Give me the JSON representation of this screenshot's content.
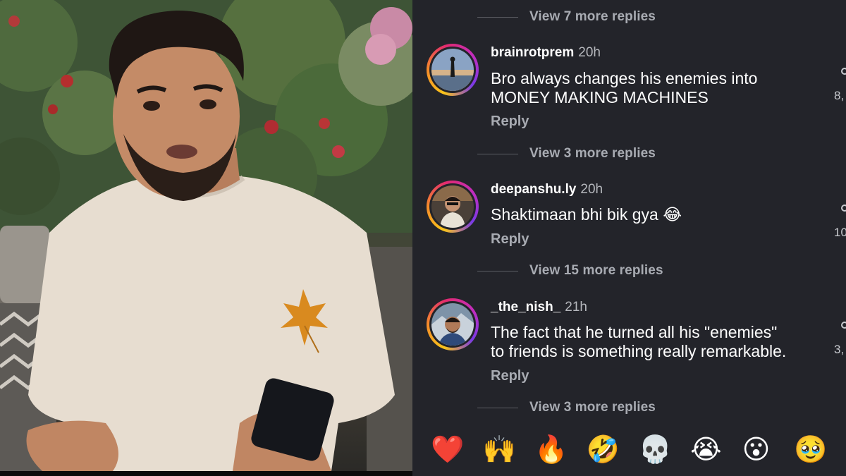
{
  "comments_panel": {
    "top_more_replies": "View 7 more replies",
    "comments": [
      {
        "username": "brainrotprem",
        "time": "20h",
        "text_lines": [
          "Bro always changes his enemies into",
          "MONEY MAKING MACHINES"
        ],
        "reply_label": "Reply",
        "like_count": "8,",
        "more_replies": "View 3 more replies"
      },
      {
        "username": "deepanshu.ly",
        "time": "20h",
        "text_lines": [
          "Shaktimaan bhi bik gya 😂"
        ],
        "reply_label": "Reply",
        "like_count": "10",
        "more_replies": "View 15 more replies"
      },
      {
        "username": "_the_nish_",
        "time": "21h",
        "text_lines": [
          "The fact that he turned all his \"enemies\"",
          "to friends is something really remarkable."
        ],
        "reply_label": "Reply",
        "like_count": "3,",
        "more_replies": "View 3 more replies"
      }
    ],
    "emoji_bar": [
      "❤️",
      "🙌",
      "🔥",
      "🤣",
      "💀",
      "😭",
      "😮",
      "🥹"
    ]
  },
  "colors": {
    "panel_bg": "#23242a",
    "muted_text": "#a8abb2",
    "story_ring": [
      "#f9c41a",
      "#e32a6e",
      "#7a3ae6"
    ]
  }
}
